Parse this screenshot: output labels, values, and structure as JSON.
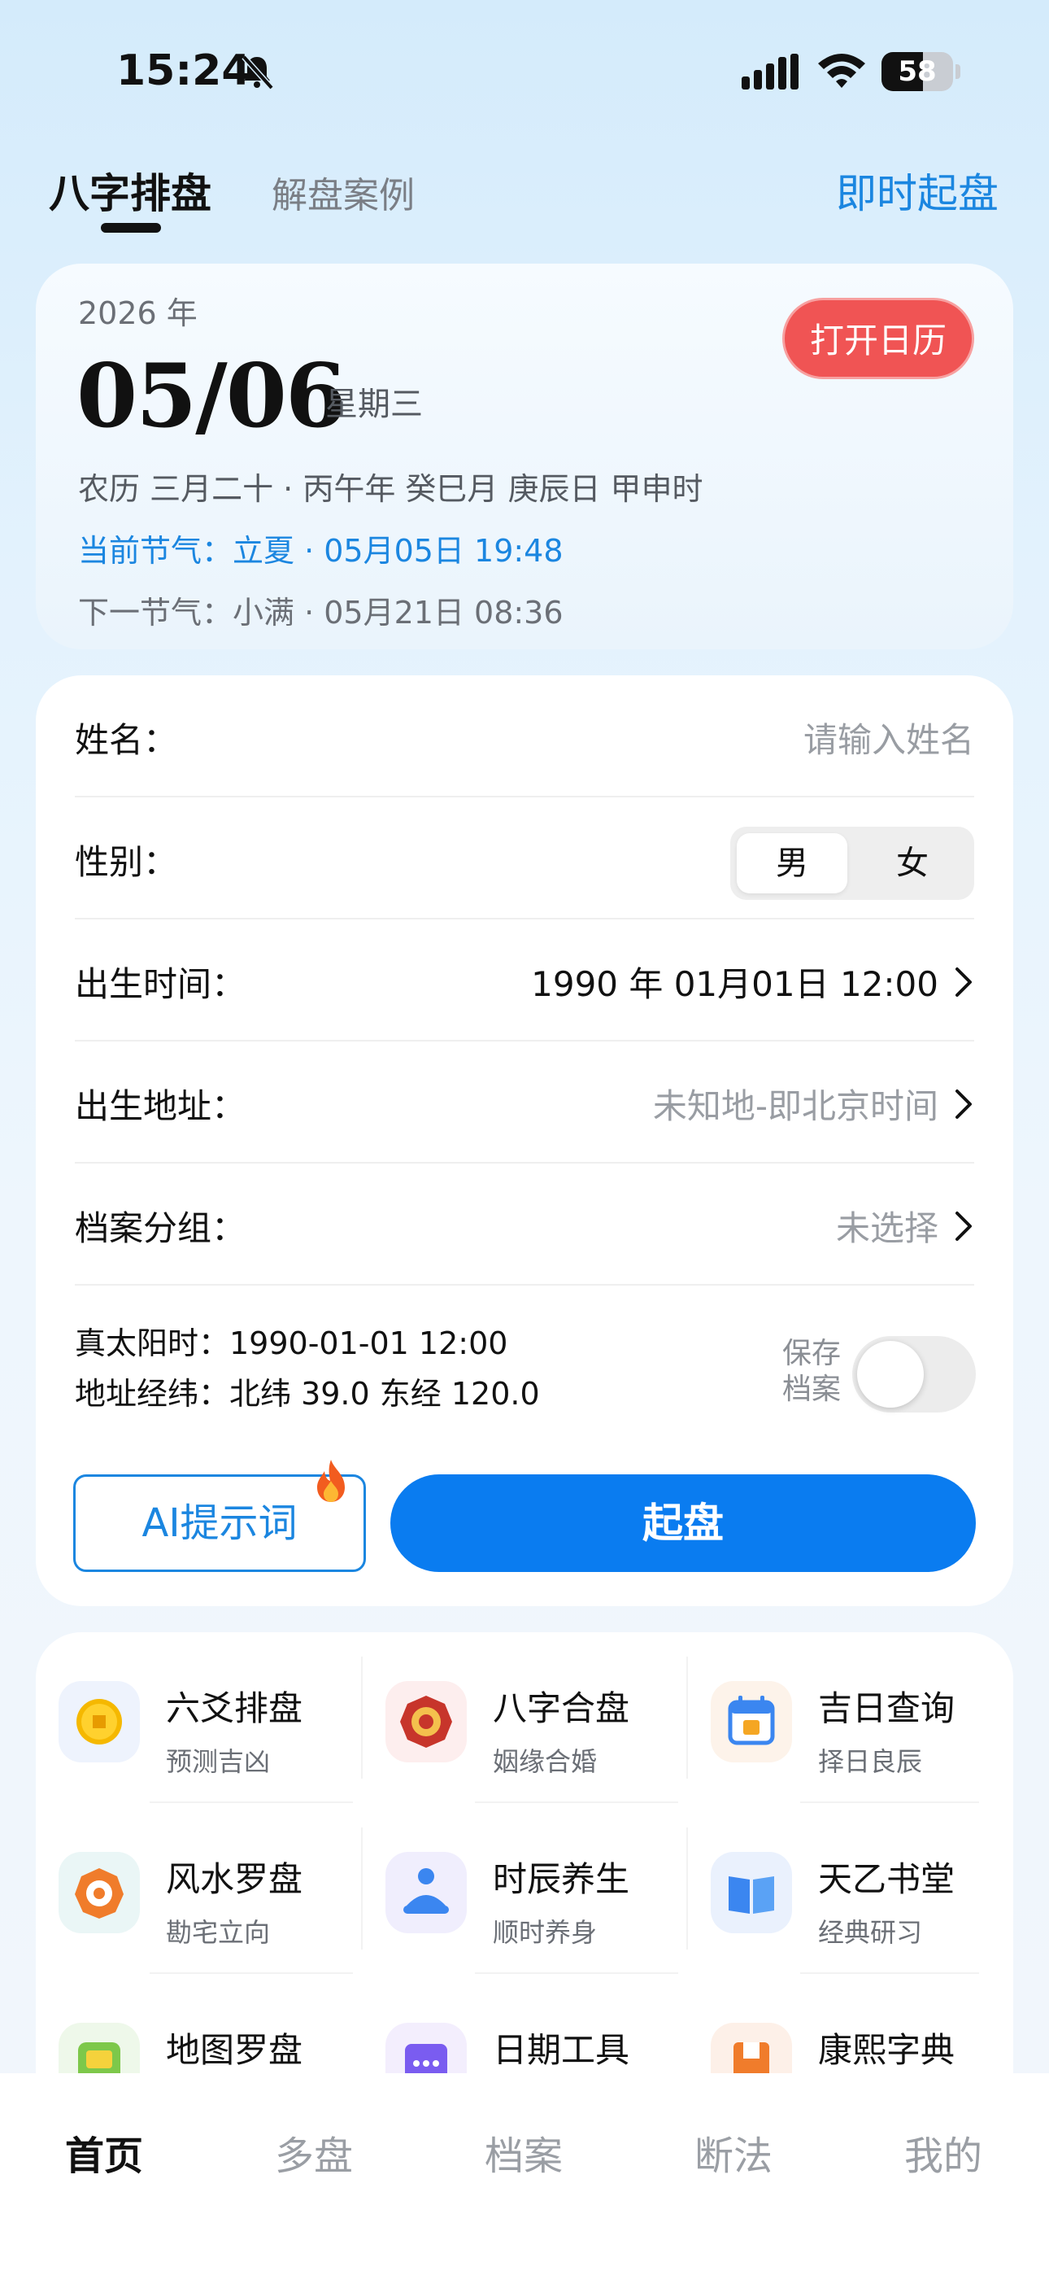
{
  "status_bar": {
    "time": "15:24",
    "battery": "58",
    "battery_level_percent": 58
  },
  "top_tabs": {
    "active": "八字排盘",
    "inactive": "解盘案例",
    "right": "即时起盘"
  },
  "date_card": {
    "year": "2026 年",
    "date": "05/06",
    "weekday": "星期三",
    "open_calendar": "打开日历",
    "lunar": "农历 三月二十 · 丙午年 癸巳月 庚辰日 甲申时",
    "current_jieqi": "当前节气：立夏 · 05月05日 19:48",
    "next_jieqi": "下一节气：小满 · 05月21日 08:36"
  },
  "form": {
    "name_label": "姓名：",
    "name_placeholder": "请输入姓名",
    "gender_label": "性别：",
    "gender_male": "男",
    "gender_female": "女",
    "birth_time_label": "出生时间：",
    "birth_time_value": "1990 年 01月01日 12:00",
    "birth_place_label": "出生地址：",
    "birth_place_value": "未知地-即北京时间",
    "group_label": "档案分组：",
    "group_value": "未选择",
    "true_solar": "真太阳时：1990-01-01 12:00",
    "coords": "地址经纬：北纬 39.0 东经 120.0",
    "save_label_1": "保存",
    "save_label_2": "档案",
    "ai_button": "AI提示词",
    "qipan_button": "起盘"
  },
  "tools": [
    {
      "name": "六爻排盘",
      "sub": "预测吉凶",
      "icon": "coin-icon",
      "bg": "#eef3fd"
    },
    {
      "name": "八字合盘",
      "sub": "姻缘合婚",
      "icon": "bagua-icon",
      "bg": "#fdeeee"
    },
    {
      "name": "吉日查询",
      "sub": "择日良辰",
      "icon": "calendar-icon",
      "bg": "#fdf3ea"
    },
    {
      "name": "风水罗盘",
      "sub": "勘宅立向",
      "icon": "compass-icon",
      "bg": "#eaf6f6"
    },
    {
      "name": "时辰养生",
      "sub": "顺时养身",
      "icon": "meditation-icon",
      "bg": "#f0eefd"
    },
    {
      "name": "天乙书堂",
      "sub": "经典研习",
      "icon": "book-icon",
      "bg": "#eaf1fd"
    },
    {
      "name": "地图罗盘",
      "sub": "",
      "icon": "map-icon",
      "bg": "#eef8ea"
    },
    {
      "name": "日期工具",
      "sub": "",
      "icon": "date-tool-icon",
      "bg": "#f3eefd"
    },
    {
      "name": "康熙字典",
      "sub": "",
      "icon": "dictionary-icon",
      "bg": "#fdf0e8"
    }
  ],
  "bottom_nav": [
    "首页",
    "多盘",
    "档案",
    "断法",
    "我的"
  ],
  "colors": {
    "accent": "#0a7cf0",
    "link": "#1b86e0",
    "danger": "#f05454"
  }
}
